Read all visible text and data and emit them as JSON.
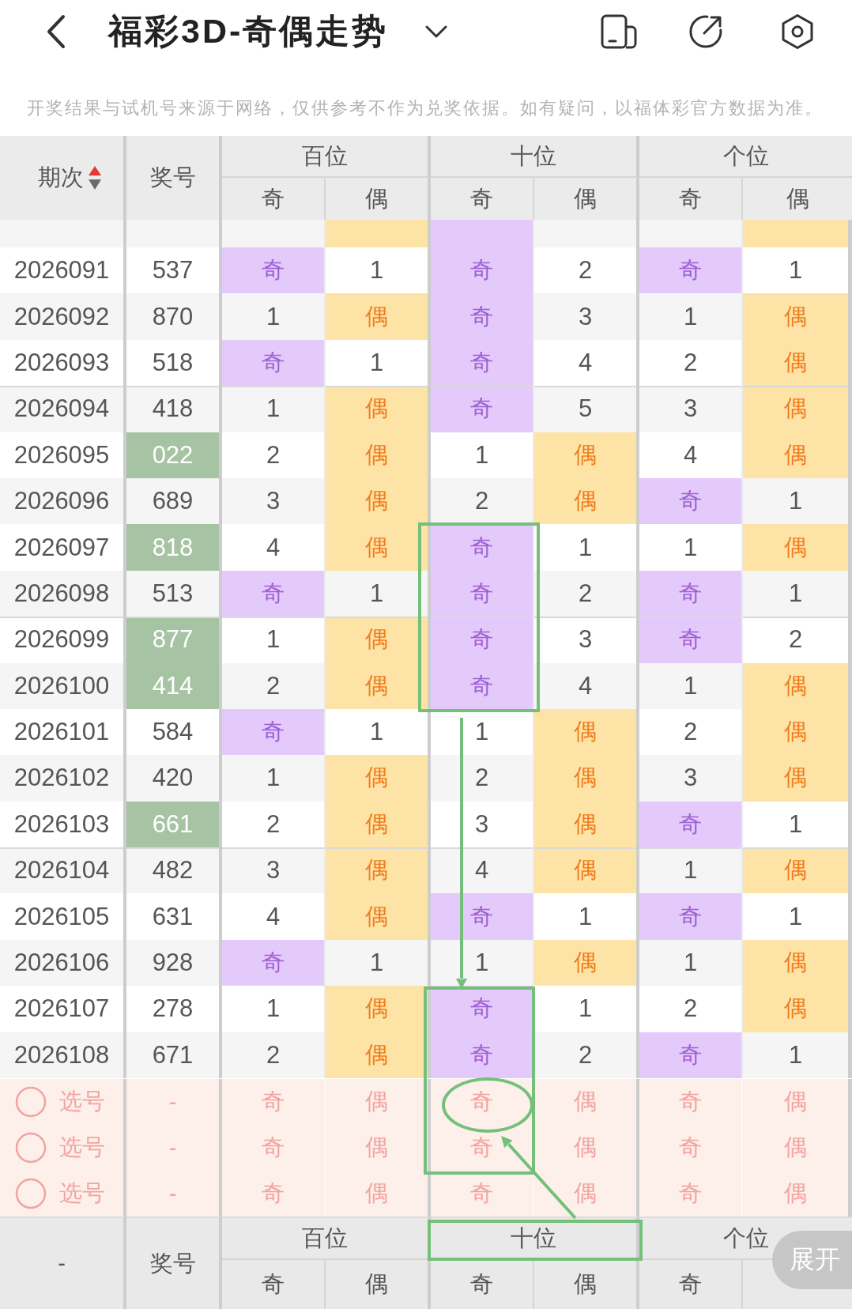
{
  "header": {
    "title": "福彩3D-奇偶走势"
  },
  "notice": "开奖结果与试机号来源于网络，仅供参考不作为兑奖依据。如有疑问，以福体彩官方数据为准。",
  "table": {
    "columns": [
      {
        "label": "期次",
        "sort_ascending": true
      },
      {
        "label": "奖号"
      }
    ],
    "groups": [
      {
        "label": "百位",
        "subcolumns": [
          "奇",
          "偶"
        ]
      },
      {
        "label": "十位",
        "subcolumns": [
          "奇",
          "偶"
        ]
      },
      {
        "label": "个位",
        "subcolumns": [
          "奇",
          "偶"
        ]
      }
    ],
    "rows": [
      {
        "highlighted": false,
        "cells": [
          {
            "hit": false
          },
          {
            "hit": true
          },
          {
            "hit": true
          },
          {
            "hit": false
          },
          {
            "hit": false
          },
          {
            "hit": true
          }
        ]
      },
      {
        "issue": "2026091",
        "number": "537",
        "highlighted": false,
        "cells": [
          {
            "text": "奇",
            "hit": true
          },
          {
            "text": "1",
            "hit": false
          },
          {
            "text": "奇",
            "hit": true
          },
          {
            "text": "2",
            "hit": false
          },
          {
            "text": "奇",
            "hit": true
          },
          {
            "text": "1",
            "hit": false
          }
        ]
      },
      {
        "issue": "2026092",
        "number": "870",
        "highlighted": false,
        "cells": [
          {
            "text": "1",
            "hit": false
          },
          {
            "text": "偶",
            "hit": true
          },
          {
            "text": "奇",
            "hit": true
          },
          {
            "text": "3",
            "hit": false
          },
          {
            "text": "1",
            "hit": false
          },
          {
            "text": "偶",
            "hit": true
          }
        ]
      },
      {
        "issue": "2026093",
        "number": "518",
        "highlighted": false,
        "cells": [
          {
            "text": "奇",
            "hit": true
          },
          {
            "text": "1",
            "hit": false
          },
          {
            "text": "奇",
            "hit": true
          },
          {
            "text": "4",
            "hit": false
          },
          {
            "text": "2",
            "hit": false
          },
          {
            "text": "偶",
            "hit": true
          }
        ]
      },
      {
        "issue": "2026094",
        "number": "418",
        "highlighted": false,
        "cells": [
          {
            "text": "1",
            "hit": false
          },
          {
            "text": "偶",
            "hit": true
          },
          {
            "text": "奇",
            "hit": true
          },
          {
            "text": "5",
            "hit": false
          },
          {
            "text": "3",
            "hit": false
          },
          {
            "text": "偶",
            "hit": true
          }
        ]
      },
      {
        "issue": "2026095",
        "number": "022",
        "highlighted": true,
        "cells": [
          {
            "text": "2",
            "hit": false
          },
          {
            "text": "偶",
            "hit": true
          },
          {
            "text": "1",
            "hit": false
          },
          {
            "text": "偶",
            "hit": true
          },
          {
            "text": "4",
            "hit": false
          },
          {
            "text": "偶",
            "hit": true
          }
        ]
      },
      {
        "issue": "2026096",
        "number": "689",
        "highlighted": false,
        "cells": [
          {
            "text": "3",
            "hit": false
          },
          {
            "text": "偶",
            "hit": true
          },
          {
            "text": "2",
            "hit": false
          },
          {
            "text": "偶",
            "hit": true
          },
          {
            "text": "奇",
            "hit": true
          },
          {
            "text": "1",
            "hit": false
          }
        ]
      },
      {
        "issue": "2026097",
        "number": "818",
        "highlighted": true,
        "cells": [
          {
            "text": "4",
            "hit": false
          },
          {
            "text": "偶",
            "hit": true
          },
          {
            "text": "奇",
            "hit": true
          },
          {
            "text": "1",
            "hit": false
          },
          {
            "text": "1",
            "hit": false
          },
          {
            "text": "偶",
            "hit": true
          }
        ]
      },
      {
        "issue": "2026098",
        "number": "513",
        "highlighted": false,
        "cells": [
          {
            "text": "奇",
            "hit": true
          },
          {
            "text": "1",
            "hit": false
          },
          {
            "text": "奇",
            "hit": true
          },
          {
            "text": "2",
            "hit": false
          },
          {
            "text": "奇",
            "hit": true
          },
          {
            "text": "1",
            "hit": false
          }
        ]
      },
      {
        "issue": "2026099",
        "number": "877",
        "highlighted": true,
        "cells": [
          {
            "text": "1",
            "hit": false
          },
          {
            "text": "偶",
            "hit": true
          },
          {
            "text": "奇",
            "hit": true
          },
          {
            "text": "3",
            "hit": false
          },
          {
            "text": "奇",
            "hit": true
          },
          {
            "text": "2",
            "hit": false
          }
        ]
      },
      {
        "issue": "2026100",
        "number": "414",
        "highlighted": true,
        "cells": [
          {
            "text": "2",
            "hit": false
          },
          {
            "text": "偶",
            "hit": true
          },
          {
            "text": "奇",
            "hit": true
          },
          {
            "text": "4",
            "hit": false
          },
          {
            "text": "1",
            "hit": false
          },
          {
            "text": "偶",
            "hit": true
          }
        ]
      },
      {
        "issue": "2026101",
        "number": "584",
        "highlighted": false,
        "cells": [
          {
            "text": "奇",
            "hit": true
          },
          {
            "text": "1",
            "hit": false
          },
          {
            "text": "1",
            "hit": false
          },
          {
            "text": "偶",
            "hit": true
          },
          {
            "text": "2",
            "hit": false
          },
          {
            "text": "偶",
            "hit": true
          }
        ]
      },
      {
        "issue": "2026102",
        "number": "420",
        "highlighted": false,
        "cells": [
          {
            "text": "1",
            "hit": false
          },
          {
            "text": "偶",
            "hit": true
          },
          {
            "text": "2",
            "hit": false
          },
          {
            "text": "偶",
            "hit": true
          },
          {
            "text": "3",
            "hit": false
          },
          {
            "text": "偶",
            "hit": true
          }
        ]
      },
      {
        "issue": "2026103",
        "number": "661",
        "highlighted": true,
        "cells": [
          {
            "text": "2",
            "hit": false
          },
          {
            "text": "偶",
            "hit": true
          },
          {
            "text": "3",
            "hit": false
          },
          {
            "text": "偶",
            "hit": true
          },
          {
            "text": "奇",
            "hit": true
          },
          {
            "text": "1",
            "hit": false
          }
        ]
      },
      {
        "issue": "2026104",
        "number": "482",
        "highlighted": false,
        "cells": [
          {
            "text": "3",
            "hit": false
          },
          {
            "text": "偶",
            "hit": true
          },
          {
            "text": "4",
            "hit": false
          },
          {
            "text": "偶",
            "hit": true
          },
          {
            "text": "1",
            "hit": false
          },
          {
            "text": "偶",
            "hit": true
          }
        ]
      },
      {
        "issue": "2026105",
        "number": "631",
        "highlighted": false,
        "cells": [
          {
            "text": "4",
            "hit": false
          },
          {
            "text": "偶",
            "hit": true
          },
          {
            "text": "奇",
            "hit": true
          },
          {
            "text": "1",
            "hit": false
          },
          {
            "text": "奇",
            "hit": true
          },
          {
            "text": "1",
            "hit": false
          }
        ]
      },
      {
        "issue": "2026106",
        "number": "928",
        "highlighted": false,
        "cells": [
          {
            "text": "奇",
            "hit": true
          },
          {
            "text": "1",
            "hit": false
          },
          {
            "text": "1",
            "hit": false
          },
          {
            "text": "偶",
            "hit": true
          },
          {
            "text": "1",
            "hit": false
          },
          {
            "text": "偶",
            "hit": true
          }
        ]
      },
      {
        "issue": "2026107",
        "number": "278",
        "highlighted": false,
        "cells": [
          {
            "text": "1",
            "hit": false
          },
          {
            "text": "偶",
            "hit": true
          },
          {
            "text": "奇",
            "hit": true
          },
          {
            "text": "1",
            "hit": false
          },
          {
            "text": "2",
            "hit": false
          },
          {
            "text": "偶",
            "hit": true
          }
        ]
      },
      {
        "issue": "2026108",
        "number": "671",
        "highlighted": false,
        "cells": [
          {
            "text": "2",
            "hit": false
          },
          {
            "text": "偶",
            "hit": true
          },
          {
            "text": "奇",
            "hit": true
          },
          {
            "text": "2",
            "hit": false
          },
          {
            "text": "奇",
            "hit": true
          },
          {
            "text": "1",
            "hit": false
          }
        ]
      }
    ]
  },
  "pick_rows": [
    {
      "checked": false,
      "label": "选号",
      "number": "-",
      "options": [
        {
          "text": "奇",
          "selected": false
        },
        {
          "text": "偶",
          "selected": false
        },
        {
          "text": "奇",
          "selected": false
        },
        {
          "text": "偶",
          "selected": false
        },
        {
          "text": "奇",
          "selected": false
        },
        {
          "text": "偶",
          "selected": false
        }
      ]
    },
    {
      "checked": false,
      "label": "选号",
      "number": "-",
      "options": [
        {
          "text": "奇",
          "selected": false
        },
        {
          "text": "偶",
          "selected": false
        },
        {
          "text": "奇",
          "selected": false
        },
        {
          "text": "偶",
          "selected": false
        },
        {
          "text": "奇",
          "selected": false
        },
        {
          "text": "偶",
          "selected": false
        }
      ]
    },
    {
      "checked": false,
      "label": "选号",
      "number": "-",
      "options": [
        {
          "text": "奇",
          "selected": false
        },
        {
          "text": "偶",
          "selected": false
        },
        {
          "text": "奇",
          "selected": false
        },
        {
          "text": "偶",
          "selected": false
        },
        {
          "text": "奇",
          "selected": false
        },
        {
          "text": "偶",
          "selected": false
        }
      ]
    }
  ],
  "footer_header": {
    "columns": [
      {
        "label": "-"
      },
      {
        "label": "奖号"
      }
    ],
    "groups": [
      {
        "label": "百位",
        "subcolumns": [
          "奇",
          "偶"
        ]
      },
      {
        "label": "十位",
        "subcolumns": [
          "奇",
          "偶"
        ]
      },
      {
        "label": "个位",
        "subcolumns": [
          "奇"
        ]
      }
    ]
  },
  "expand_button": {
    "label": "展开"
  }
}
